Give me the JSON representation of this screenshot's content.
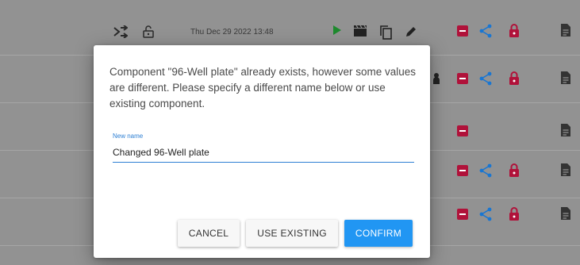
{
  "table": {
    "rows": [
      {
        "date": "Thu Dec 29 2022 13:48",
        "has_share": true,
        "has_lock": true
      },
      {
        "date": "",
        "has_share": true,
        "has_lock": true
      },
      {
        "date": "",
        "has_share": false,
        "has_lock": false
      },
      {
        "date": "",
        "has_share": true,
        "has_lock": true
      },
      {
        "date": "",
        "has_share": true,
        "has_lock": true
      }
    ]
  },
  "dialog": {
    "message": "Component \"96-Well plate\" already exists, however some values are different. Please specify a different name below or use existing component.",
    "field_label": "New name",
    "field_value": "Changed 96-Well plate",
    "cancel_label": "CANCEL",
    "use_existing_label": "USE EXISTING",
    "confirm_label": "CONFIRM"
  },
  "colors": {
    "accent": "#2196f3",
    "danger": "#b0123a",
    "share": "#1976d2",
    "run": "#1e8a2e"
  }
}
